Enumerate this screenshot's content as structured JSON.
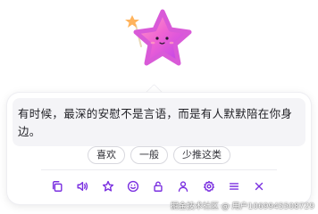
{
  "assistant": {
    "mascot": "star-mascot",
    "quote": "有时候，最深的安慰不是言语，而是有人默默陪在你身边。"
  },
  "feedback": {
    "like": "喜欢",
    "neutral": "一般",
    "less": "少推这类"
  },
  "toolbar": {
    "icons": [
      "copy-icon",
      "speaker-icon",
      "star-icon",
      "smiley-icon",
      "lock-icon",
      "user-icon",
      "gear-icon",
      "menu-icon",
      "close-icon"
    ],
    "accent": "#7a2fe0"
  },
  "watermark": "掘金技术社区 @ 用户1069945508729"
}
